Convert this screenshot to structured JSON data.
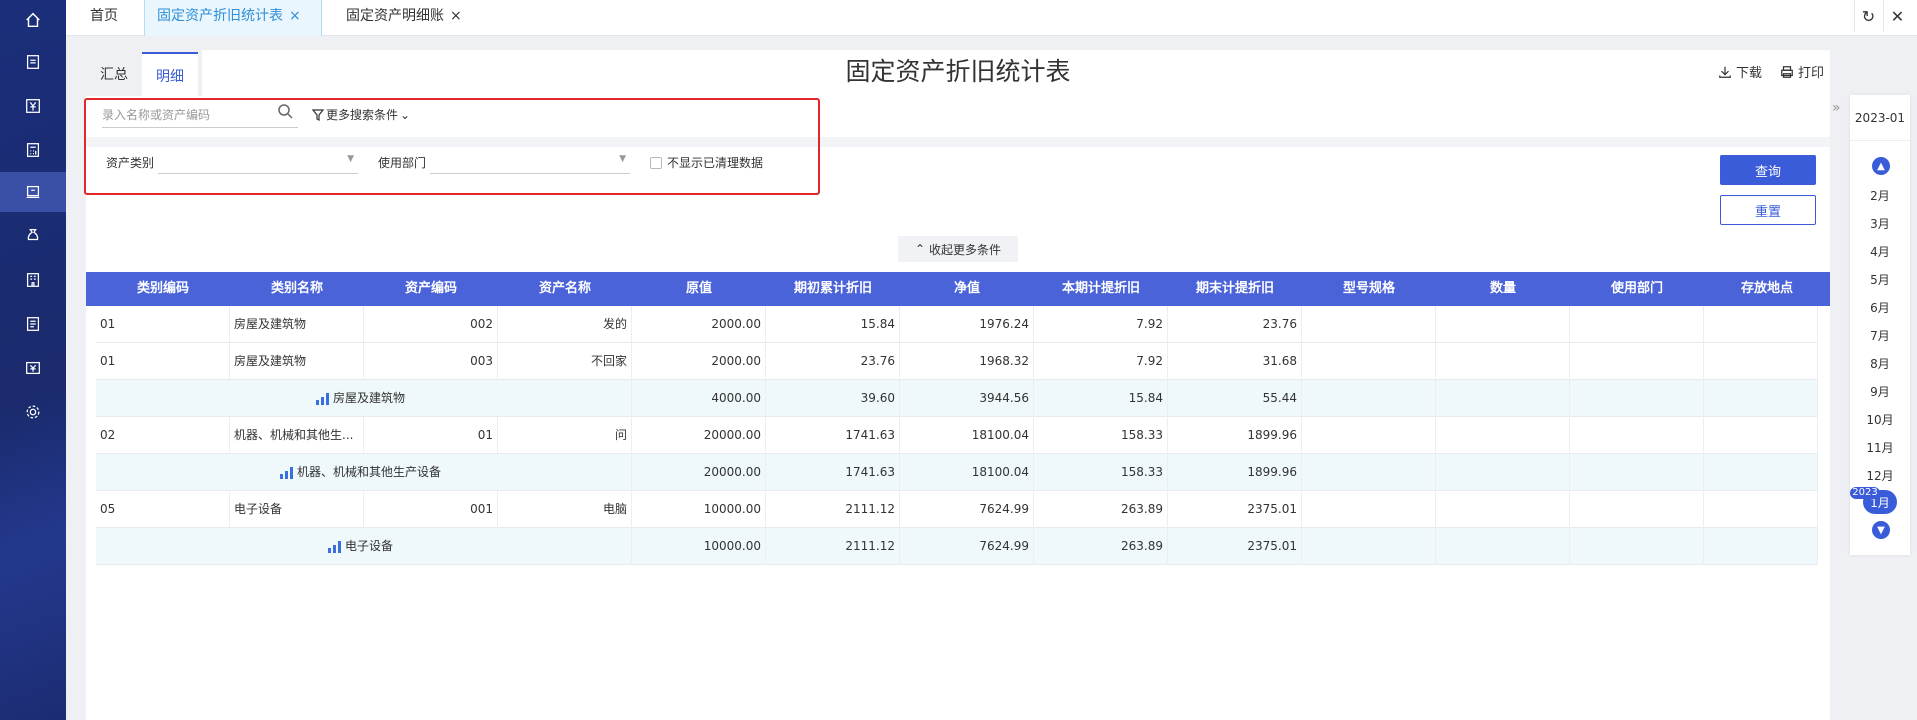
{
  "tabs": [
    {
      "label": "首页",
      "close": ""
    },
    {
      "label": "固定资产折旧统计表",
      "close": "×"
    },
    {
      "label": "固定资产明细账",
      "close": "×"
    }
  ],
  "tools": {
    "refresh": "↻",
    "close": "✕"
  },
  "nav_icons": [
    "home-icon",
    "voucher-icon",
    "currency-icon",
    "calculator-icon",
    "asset-icon",
    "money-bag-icon",
    "building-icon",
    "report-icon",
    "tax-icon",
    "gear-icon"
  ],
  "report": {
    "title": "固定资产折旧统计表",
    "subtabs": [
      "汇总",
      "明细"
    ],
    "download": "下载",
    "print": "打印"
  },
  "search": {
    "placeholder": "录入名称或资产编码",
    "more_conditions": "更多搜索条件",
    "asset_category_label": "资产类别",
    "department_label": "使用部门",
    "hide_cleared": "不显示已清理数据",
    "collapse": "收起更多条件",
    "query": "查询",
    "reset": "重置"
  },
  "table": {
    "headers": [
      "类别编码",
      "类别名称",
      "资产编码",
      "资产名称",
      "原值",
      "期初累计折旧",
      "净值",
      "本期计提折旧",
      "期末计提折旧",
      "型号规格",
      "数量",
      "使用部门",
      "存放地点"
    ],
    "rows": [
      {
        "type": "data",
        "cat_code": "01",
        "cat_name": "房屋及建筑物",
        "asset_code": "002",
        "asset_name": "发的",
        "orig": "2000.00",
        "open_dep": "15.84",
        "net": "1976.24",
        "cur_dep": "7.92",
        "end_dep": "23.76"
      },
      {
        "type": "data",
        "cat_code": "01",
        "cat_name": "房屋及建筑物",
        "asset_code": "003",
        "asset_name": "不回家",
        "orig": "2000.00",
        "open_dep": "23.76",
        "net": "1968.32",
        "cur_dep": "7.92",
        "end_dep": "31.68"
      },
      {
        "type": "subtotal",
        "label": "房屋及建筑物",
        "orig": "4000.00",
        "open_dep": "39.60",
        "net": "3944.56",
        "cur_dep": "15.84",
        "end_dep": "55.44"
      },
      {
        "type": "data",
        "cat_code": "02",
        "cat_name": "机器、机械和其他生...",
        "asset_code": "01",
        "asset_name": "问",
        "orig": "20000.00",
        "open_dep": "1741.63",
        "net": "18100.04",
        "cur_dep": "158.33",
        "end_dep": "1899.96"
      },
      {
        "type": "subtotal",
        "label": "机器、机械和其他生产设备",
        "orig": "20000.00",
        "open_dep": "1741.63",
        "net": "18100.04",
        "cur_dep": "158.33",
        "end_dep": "1899.96"
      },
      {
        "type": "data",
        "cat_code": "05",
        "cat_name": "电子设备",
        "asset_code": "001",
        "asset_name": "电脑",
        "orig": "10000.00",
        "open_dep": "2111.12",
        "net": "7624.99",
        "cur_dep": "263.89",
        "end_dep": "2375.01"
      },
      {
        "type": "subtotal",
        "label": "电子设备",
        "orig": "10000.00",
        "open_dep": "2111.12",
        "net": "7624.99",
        "cur_dep": "263.89",
        "end_dep": "2375.01"
      }
    ]
  },
  "period": {
    "current": "2023-01",
    "months": [
      "2月",
      "3月",
      "4月",
      "5月",
      "6月",
      "7月",
      "8月",
      "9月",
      "10月",
      "11月",
      "12月"
    ],
    "selected_year": "2023",
    "selected_month": "1月"
  }
}
